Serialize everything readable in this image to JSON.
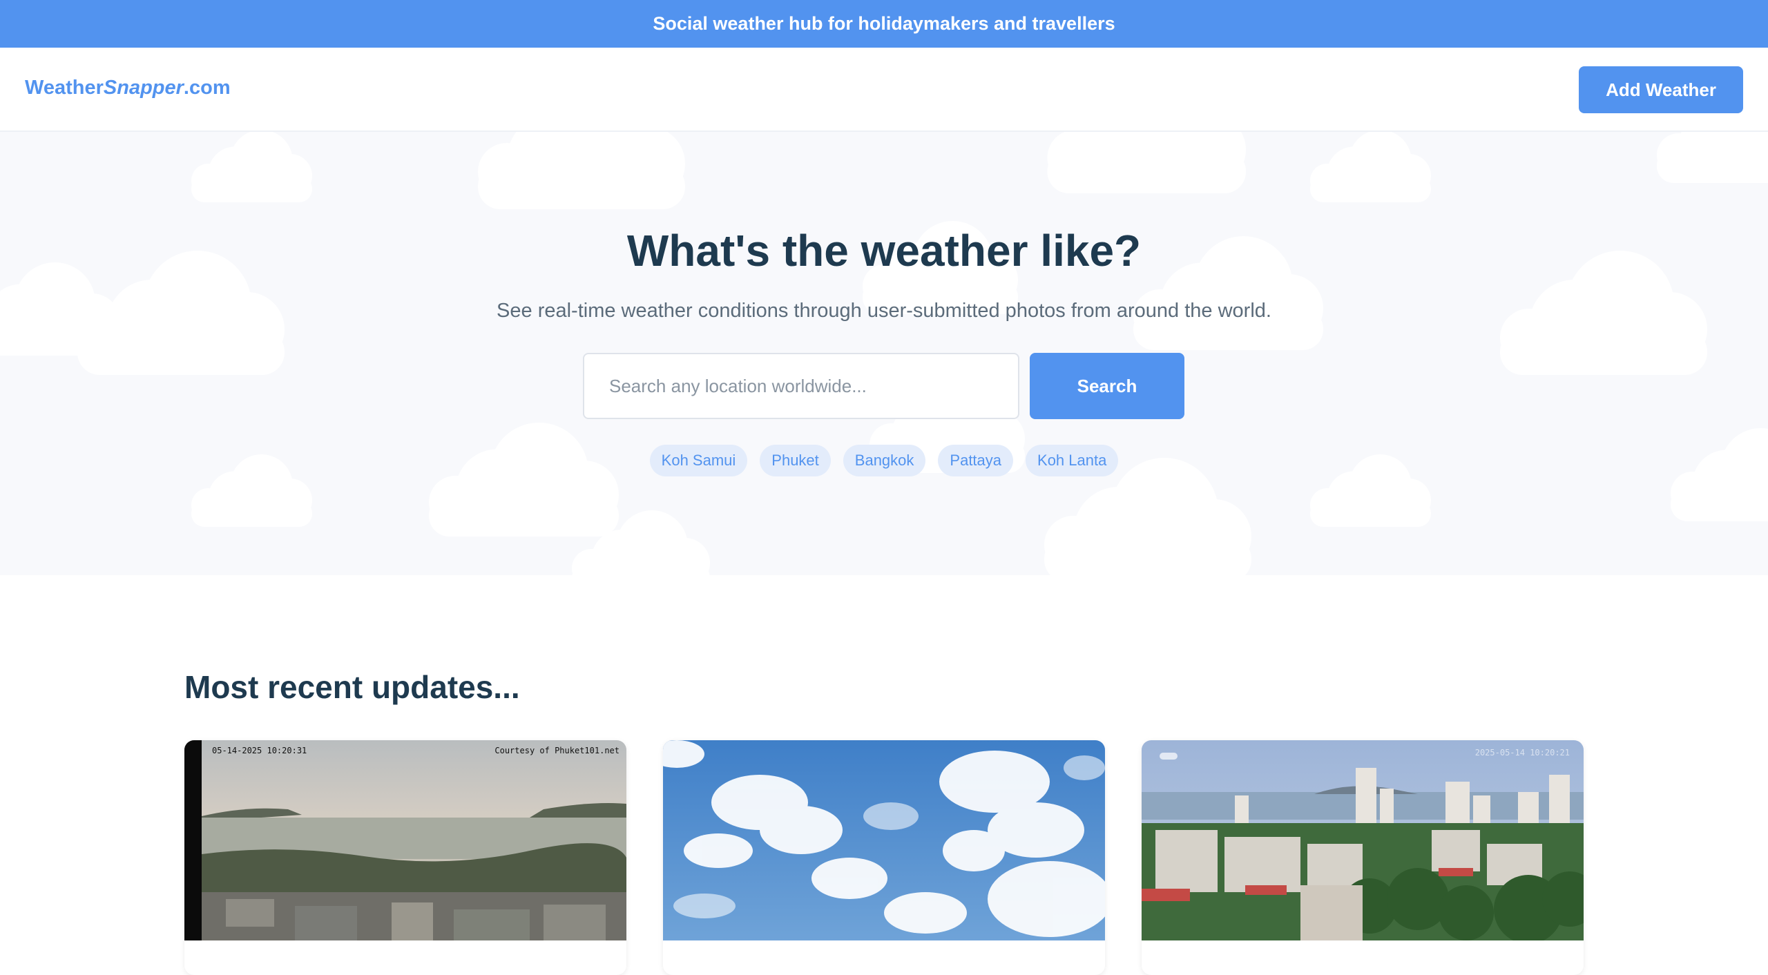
{
  "banner": {
    "text": "Social weather hub for holidaymakers and travellers"
  },
  "header": {
    "logo_prefix": "Weather",
    "logo_italic": "Snapper",
    "logo_suffix": ".com",
    "add_button": "Add Weather"
  },
  "hero": {
    "title": "What's the weather like?",
    "subtitle": "See real-time weather conditions through user-submitted photos from around the world.",
    "search_placeholder": "Search any location worldwide...",
    "search_button": "Search",
    "tags": [
      "Koh Samui",
      "Phuket",
      "Bangkok",
      "Pattaya",
      "Koh Lanta"
    ]
  },
  "recent": {
    "title": "Most recent updates...",
    "cards": [
      {
        "timestamp": "05-14-2025 10:20:31",
        "credit": "Courtesy of Phuket101.net"
      },
      {},
      {
        "timestamp": "2025-05-14 10:20:21"
      }
    ]
  },
  "colors": {
    "accent": "#5293ef",
    "heading": "#1e3a4f",
    "hero_bg": "#f8f9fc"
  }
}
